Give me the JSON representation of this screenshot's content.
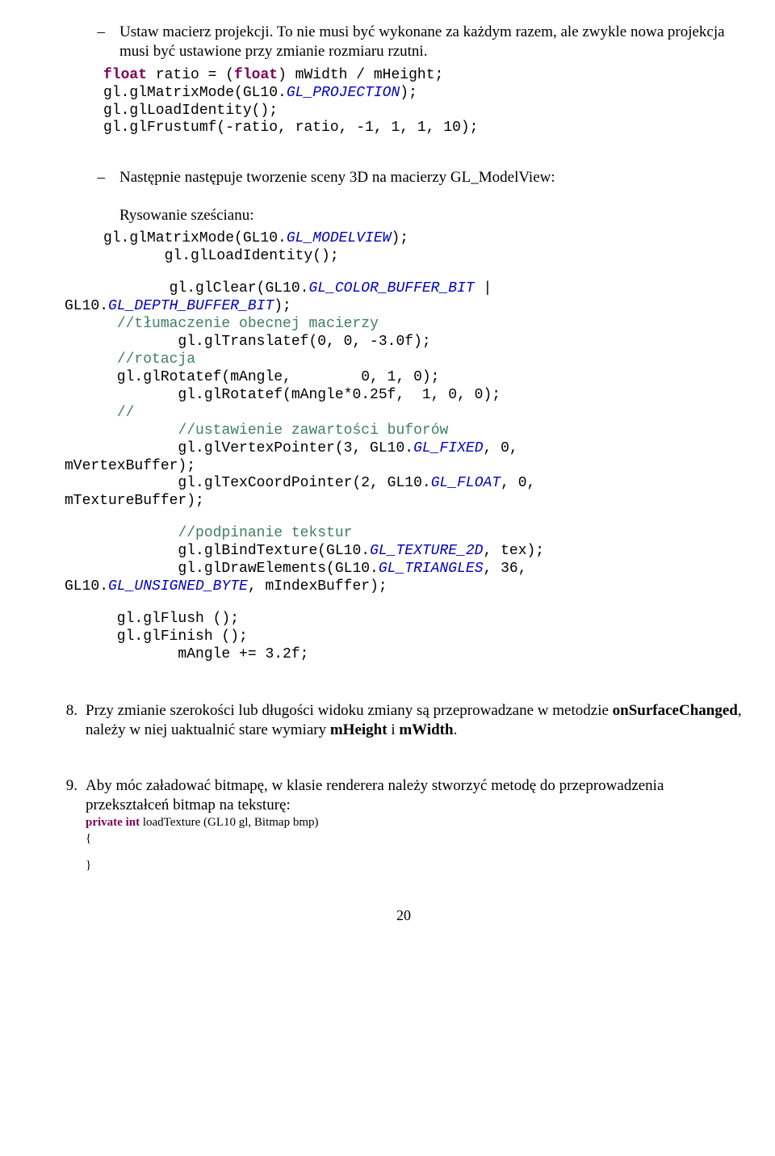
{
  "item1": {
    "text": "Ustaw macierz projekcji. To nie musi być wykonane za każdym razem, ale zwykle nowa projekcja musi być ustawione przy zmianie rozmiaru rzutni."
  },
  "code1": {
    "l1a": "float",
    "l1b": " ratio = (",
    "l1c": "float",
    "l1d": ") mWidth / mHeight;",
    "l2a": "gl.glMatrixMode(GL10.",
    "l2b": "GL_PROJECTION",
    "l2c": ");",
    "l3": "gl.glLoadIdentity();",
    "l4": "gl.glFrustumf(-ratio, ratio, -1, 1, 1, 10);"
  },
  "item2": {
    "text": "Następnie następuje tworzenie sceny 3D na macierzy GL_ModelView:",
    "sub": "Rysowanie sześcianu:"
  },
  "code2": {
    "l1a": "gl.glMatrixMode(GL10.",
    "l1b": "GL_MODELVIEW",
    "l1c": ");",
    "l2": "       gl.glLoadIdentity();"
  },
  "code3": {
    "l1a": "            gl.glClear(GL10.",
    "l1b": "GL_COLOR_BUFFER_BIT",
    "l1c": " |",
    "l2a": "GL10.",
    "l2b": "GL_DEPTH_BUFFER_BIT",
    "l2c": ");",
    "l3a": "      ",
    "l3b": "//tłumaczenie obecnej macierzy",
    "l4": "             gl.glTranslatef(0, 0, -3.0f);",
    "l5a": "      ",
    "l5b": "//rotacja",
    "l6": "      gl.glRotatef(mAngle,        0, 1, 0);",
    "l7": "             gl.glRotatef(mAngle*0.25f,  1, 0, 0);",
    "l8a": "      ",
    "l8b": "//",
    "l9a": "             ",
    "l9b": "//ustawienie zawartości buforów",
    "l10a": "             gl.glVertexPointer(3, GL10.",
    "l10b": "GL_FIXED",
    "l10c": ", 0,",
    "l11": "mVertexBuffer);",
    "l12a": "             gl.glTexCoordPointer(2, GL10.",
    "l12b": "GL_FLOAT",
    "l12c": ", 0,",
    "l13": "mTextureBuffer);"
  },
  "code4": {
    "l1a": "             ",
    "l1b": "//podpinanie tekstur",
    "l2a": "             gl.glBindTexture(GL10.",
    "l2b": "GL_TEXTURE_2D",
    "l2c": ", tex);",
    "l3a": "             gl.glDrawElements(GL10.",
    "l3b": "GL_TRIANGLES",
    "l3c": ", 36,",
    "l4a": "GL10.",
    "l4b": "GL_UNSIGNED_BYTE",
    "l4c": ", mIndexBuffer);"
  },
  "code5": {
    "l1": "      gl.glFlush ();",
    "l2": "      gl.glFinish ();",
    "l3": "             mAngle += 3.2f;"
  },
  "num8": {
    "num": "8.",
    "p1": "Przy zmianie szerokości lub długości widoku zmiany są przeprowadzane w metodzie ",
    "b1": "onSurfaceChanged",
    "p2": ", należy w niej uaktualnić stare wymiary ",
    "b2": "mHeight",
    "p3": " i ",
    "b3": "mWidth",
    "p4": "."
  },
  "num9": {
    "num": "9.",
    "text": "Aby móc załadować bitmapę, w klasie renderera należy stworzyć metodę do przeprowadzenia przekształceń bitmap na teksturę:",
    "code_kw1": "private int ",
    "code_rest": "loadTexture (GL10 gl, Bitmap bmp)",
    "brace_open": "{",
    "brace_close": "}"
  },
  "pagenum": "20"
}
